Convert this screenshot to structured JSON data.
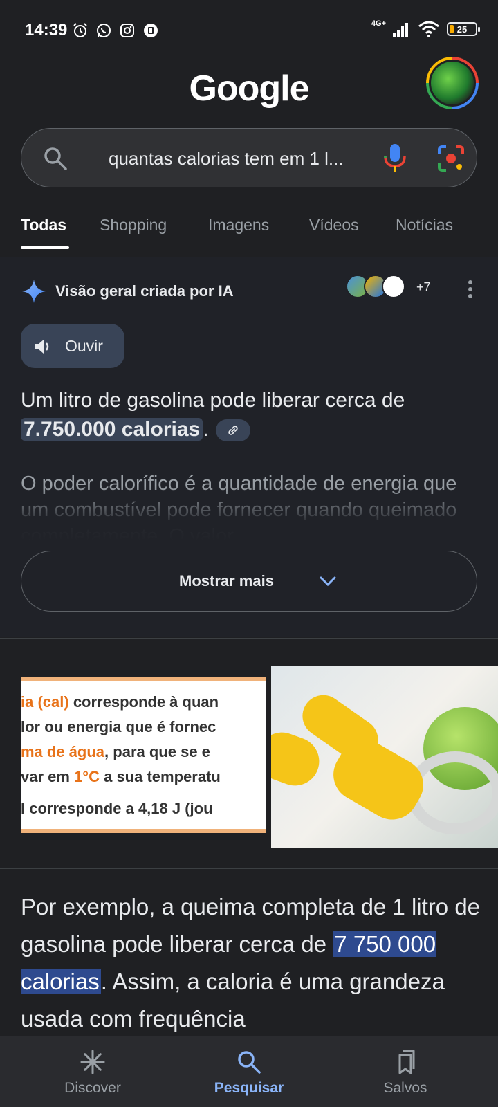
{
  "status_bar": {
    "time": "14:39",
    "network": "4G+",
    "battery": "25",
    "notification_icons": [
      "alarm-icon",
      "whatsapp-icon",
      "instagram-icon",
      "notification-icon"
    ]
  },
  "header": {
    "logo": "Google",
    "avatar": "avatar"
  },
  "search": {
    "query": "quantas calorias tem em 1 l..."
  },
  "tabs": [
    {
      "label": "Todas",
      "active": true
    },
    {
      "label": "Shopping"
    },
    {
      "label": "Imagens"
    },
    {
      "label": "Vídeos"
    },
    {
      "label": "Notícias"
    }
  ],
  "ai_overview": {
    "title": "Visão geral criada por IA",
    "sources_count": "+7",
    "listen_label": "Ouvir",
    "answer_prefix": "Um litro de gasolina pode liberar cerca de ",
    "answer_highlight": "7.750.000 calorias",
    "answer_suffix": ".",
    "continuation": "O poder calorífico é a quantidade de energia que um combustível pode fornecer quando queimado completamente. O valor",
    "show_more_label": "Mostrar mais"
  },
  "image_snippet": {
    "line1_orange": "ia (cal)",
    "line1_rest": " corresponde à quan",
    "line2": "lor ou energia que é fornec",
    "line3_orange": "ma de água",
    "line3_rest": ", para que se e",
    "line4_prefix": "var em ",
    "line4_orange": "1°C",
    "line4_rest": " a sua temperatu",
    "line5": "l corresponde a 4,18 J (jou"
  },
  "body": {
    "text_prefix": "Por exemplo, a queima completa de 1 litro de gasolina pode liberar cerca de ",
    "highlight": "7 750 000 calorias",
    "text_suffix": ". Assim, a caloria é uma grandeza usada com frequência"
  },
  "bottom_nav": [
    {
      "label": "Discover",
      "icon": "discover-icon"
    },
    {
      "label": "Pesquisar",
      "icon": "search-icon",
      "active": true
    },
    {
      "label": "Salvos",
      "icon": "saved-icon"
    }
  ],
  "colors": {
    "background": "#1f2023",
    "ai_panel": "#202228",
    "highlight": "#394457",
    "accent": "#8ab4f8",
    "selection": "#2e4a8f"
  }
}
